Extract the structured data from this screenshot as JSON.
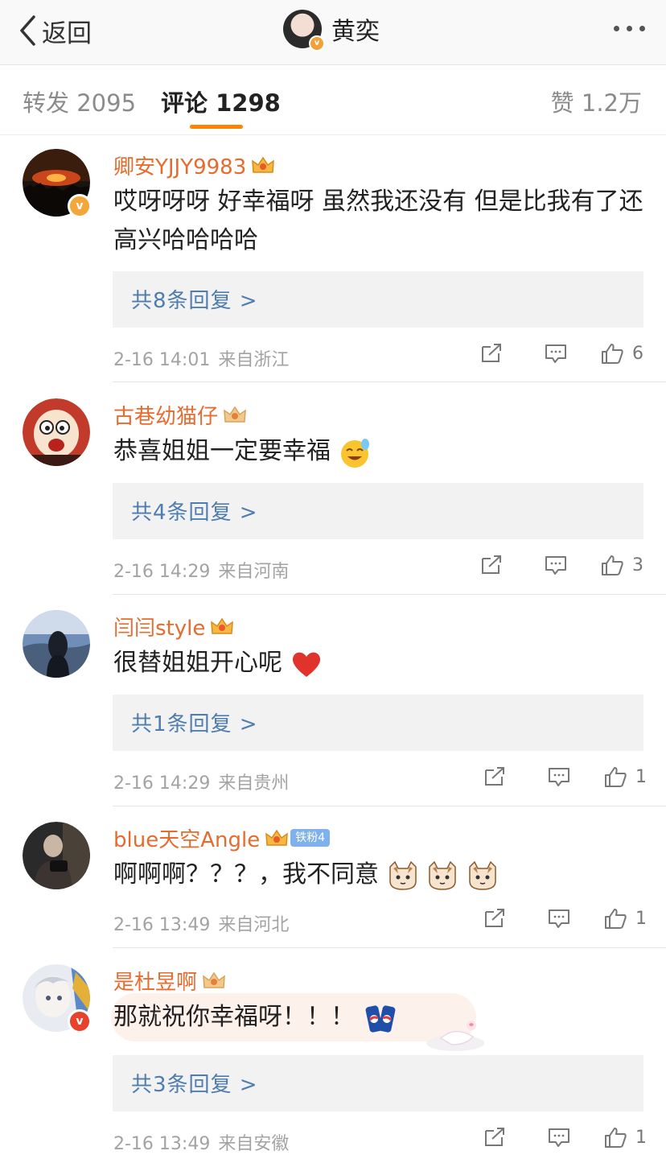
{
  "nav": {
    "back_label": "返回",
    "title": "黄奕",
    "back_icon": "chevron-left-icon",
    "more_icon": "more-dots-icon"
  },
  "tabs": {
    "repost": "转发 2095",
    "comment": "评论 1298",
    "like": "赞 1.2万",
    "accent": "#ff8200"
  },
  "colors": {
    "username": "#e86b2d",
    "reply_link": "#507daf",
    "meta": "#a3a3a3"
  },
  "comments": [
    {
      "name": "卿安YJJY9983",
      "text": "哎呀呀呀 好幸福呀 虽然我还没有 但是比我有了还高兴哈哈哈哈",
      "replies": "共8条回复 >",
      "time": "2-16 14:01",
      "from": "来自浙江",
      "likes": "6"
    },
    {
      "name": "古巷幼猫仔",
      "text": "恭喜姐姐一定要幸福",
      "replies": "共4条回复 >",
      "time": "2-16 14:29",
      "from": "来自河南",
      "likes": "3"
    },
    {
      "name": "闫闫style",
      "text": "很替姐姐开心呢",
      "replies": "共1条回复 >",
      "time": "2-16 14:29",
      "from": "来自贵州",
      "likes": "1"
    },
    {
      "name": "blue天空Angle",
      "fans_badge": "铁粉4",
      "text": "啊啊啊？？？，我不同意",
      "time": "2-16 13:49",
      "from": "来自河北",
      "likes": "1"
    },
    {
      "name": "是杜昱啊",
      "text": "那就祝你幸福呀！！！",
      "replies": "共3条回复 >",
      "time": "2-16 13:49",
      "from": "来自安徽",
      "likes": "1"
    }
  ]
}
